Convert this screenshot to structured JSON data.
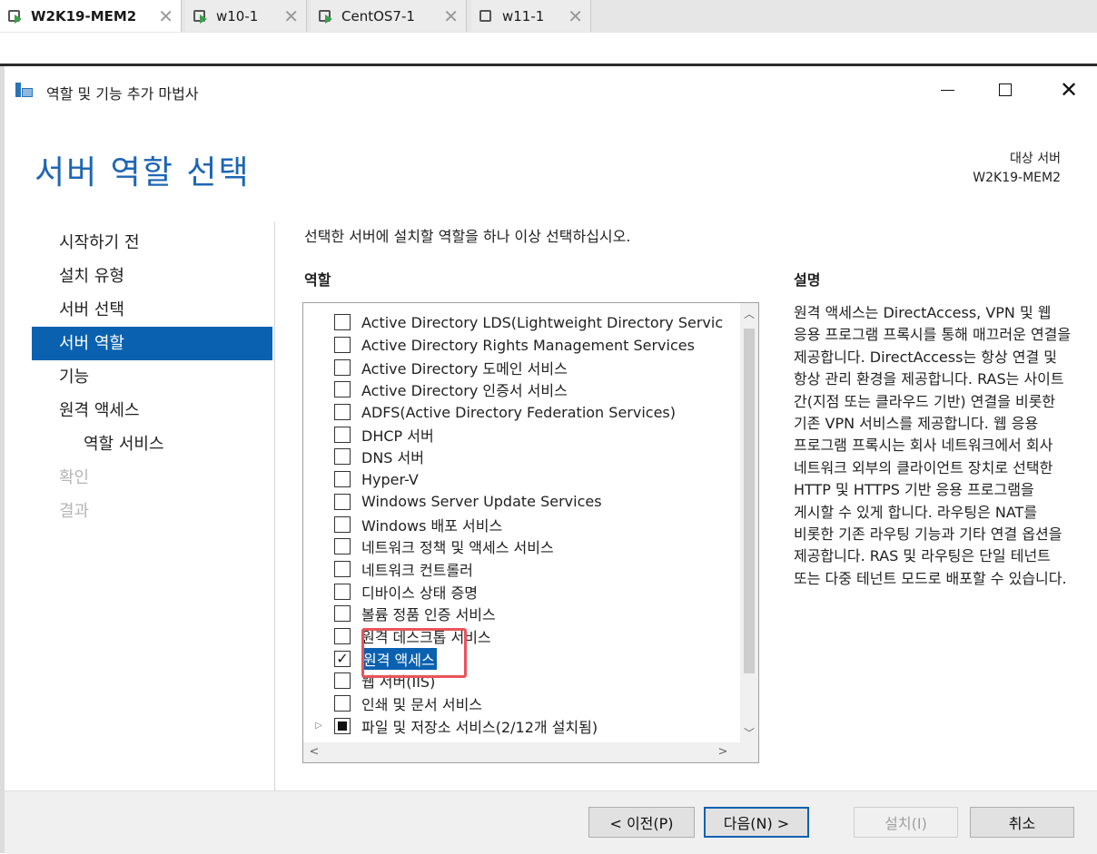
{
  "vm_tabs": [
    {
      "label": "W2K19-MEM2",
      "active": true,
      "running": true
    },
    {
      "label": "w10-1",
      "active": false,
      "running": true
    },
    {
      "label": "CentOS7-1",
      "active": false,
      "running": true
    },
    {
      "label": "w11-1",
      "active": false,
      "running": false
    }
  ],
  "window": {
    "title": "역할 및 기능 추가 마법사"
  },
  "page": {
    "heading": "서버 역할 선택",
    "target_label": "대상 서버",
    "target_server": "W2K19-MEM2"
  },
  "nav": [
    {
      "label": "시작하기 전",
      "state": "normal",
      "sub": false
    },
    {
      "label": "설치 유형",
      "state": "normal",
      "sub": false
    },
    {
      "label": "서버 선택",
      "state": "normal",
      "sub": false
    },
    {
      "label": "서버 역할",
      "state": "selected",
      "sub": false
    },
    {
      "label": "기능",
      "state": "normal",
      "sub": false
    },
    {
      "label": "원격 액세스",
      "state": "normal",
      "sub": false
    },
    {
      "label": "역할 서비스",
      "state": "normal",
      "sub": true
    },
    {
      "label": "확인",
      "state": "disabled",
      "sub": false
    },
    {
      "label": "결과",
      "state": "disabled",
      "sub": false
    }
  ],
  "main": {
    "instruction": "선택한 서버에 설치할 역할을 하나 이상 선택하십시오.",
    "roles_header": "역할",
    "desc_header": "설명"
  },
  "roles": [
    {
      "label": "Active Directory LDS(Lightweight Directory Servic",
      "state": "unchecked"
    },
    {
      "label": "Active Directory Rights Management Services",
      "state": "unchecked"
    },
    {
      "label": "Active Directory 도메인 서비스",
      "state": "unchecked"
    },
    {
      "label": "Active Directory 인증서 서비스",
      "state": "unchecked"
    },
    {
      "label": "ADFS(Active Directory Federation Services)",
      "state": "unchecked"
    },
    {
      "label": "DHCP 서버",
      "state": "unchecked"
    },
    {
      "label": "DNS 서버",
      "state": "unchecked"
    },
    {
      "label": "Hyper-V",
      "state": "unchecked"
    },
    {
      "label": "Windows Server Update Services",
      "state": "unchecked"
    },
    {
      "label": "Windows 배포 서비스",
      "state": "unchecked"
    },
    {
      "label": "네트워크 정책 및 액세스 서비스",
      "state": "unchecked"
    },
    {
      "label": "네트워크 컨트롤러",
      "state": "unchecked"
    },
    {
      "label": "디바이스 상태 증명",
      "state": "unchecked"
    },
    {
      "label": "볼륨 정품 인증 서비스",
      "state": "unchecked"
    },
    {
      "label": "원격 데스크톱 서비스",
      "state": "unchecked"
    },
    {
      "label": "원격 액세스",
      "state": "checked",
      "highlighted": true
    },
    {
      "label": "웹 서버(IIS)",
      "state": "unchecked"
    },
    {
      "label": "인쇄 및 문서 서비스",
      "state": "unchecked"
    },
    {
      "label": "파일 및 저장소 서비스(2/12개 설치됨)",
      "state": "partial",
      "expandable": true
    }
  ],
  "description": "원격 액세스는 DirectAccess, VPN 및 웹 응용 프로그램 프록시를 통해 매끄러운 연결을 제공합니다. DirectAccess는 항상 연결 및 항상 관리 환경을 제공합니다. RAS는 사이트 간(지점 또는 클라우드 기반) 연결을 비롯한 기존 VPN 서비스를 제공합니다. 웹 응용 프로그램 프록시는 회사 네트워크에서 회사 네트워크 외부의 클라이언트 장치로 선택한 HTTP 및 HTTPS 기반 응용 프로그램을 게시할 수 있게 합니다. 라우팅은 NAT를 비롯한 기존 라우팅 기능과 기타 연결 옵션을 제공합니다. RAS 및 라우팅은 단일 테넌트 또는 다중 테넌트 모드로 배포할 수 있습니다.",
  "buttons": {
    "prev": "< 이전(P)",
    "next": "다음(N) >",
    "install": "설치(I)",
    "cancel": "취소"
  },
  "colors": {
    "accent": "#0a61b0",
    "heading": "#1e66b4",
    "annotation": "#e8545a"
  }
}
